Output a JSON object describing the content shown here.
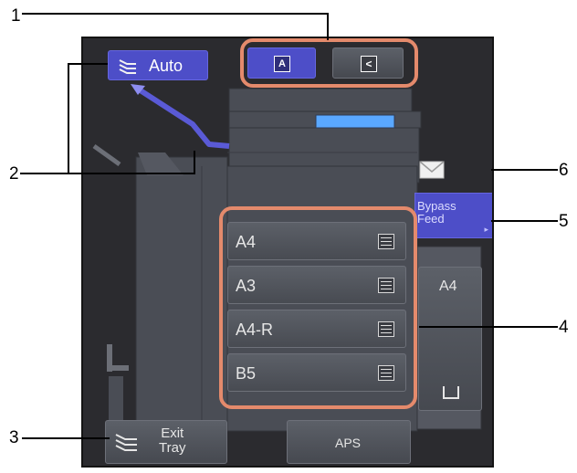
{
  "callouts": {
    "c1": "1",
    "c2": "2",
    "c3": "3",
    "c4": "4",
    "c5": "5",
    "c6": "6"
  },
  "top_buttons": {
    "original_mode_a": "A",
    "original_mode_b": "<"
  },
  "auto_button": {
    "label": "Auto"
  },
  "paper_sizes": [
    {
      "label": "A4"
    },
    {
      "label": "A3"
    },
    {
      "label": "A4-R"
    },
    {
      "label": "B5"
    }
  ],
  "bypass": {
    "line1": "Bypass",
    "line2": "Feed"
  },
  "large_tray": {
    "size": "A4"
  },
  "exit_tray": {
    "line1": "Exit",
    "line2": "Tray"
  },
  "aps": {
    "label": "APS"
  },
  "colors": {
    "highlight": "#e48a6c",
    "selected": "#4d4ec8",
    "panel": "#2b2b2f"
  },
  "icons": [
    "stack-icon",
    "envelope-icon",
    "tray-icon",
    "paper-list-icon"
  ]
}
